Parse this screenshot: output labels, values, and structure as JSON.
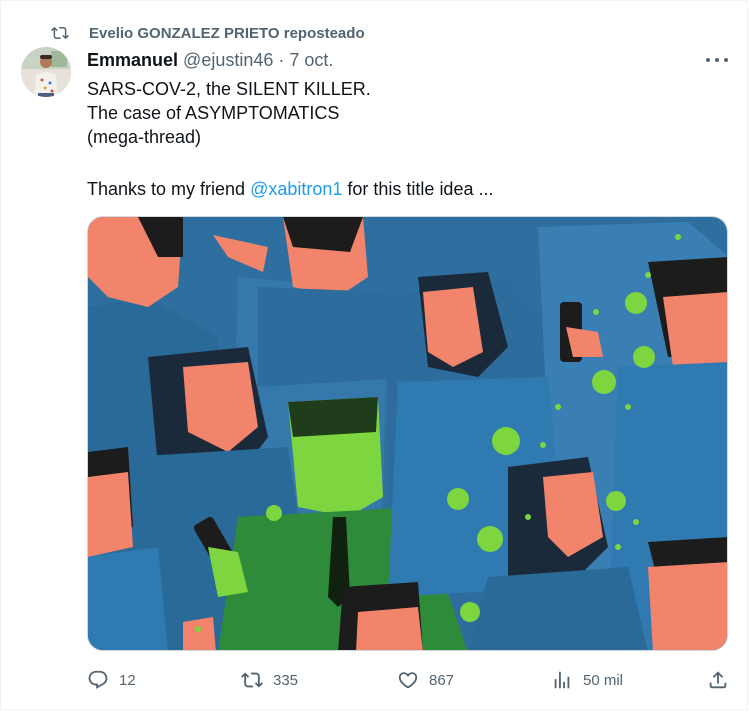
{
  "repost": {
    "icon": "repost-icon",
    "text": "Evelio GONZALEZ PRIETO reposteado"
  },
  "tweet": {
    "author_name": "Emmanuel",
    "author_handle": "@ejustin46",
    "separator": " · ",
    "date": "7 oct.",
    "lines": [
      "SARS-COV-2, the SILENT KILLER.",
      "The case of ASYMPTOMATICS",
      "(mega-thread)"
    ],
    "thanks_prefix": "Thanks to my friend ",
    "mention": "@xabitron1",
    "thanks_suffix": " for this title idea ..."
  },
  "actions": {
    "replies": "12",
    "reposts": "335",
    "likes": "867",
    "views": "50 mil"
  },
  "colors": {
    "accent": "#1d9bf0",
    "muted": "#536471",
    "media_bg": "#3a7fb3",
    "virus_green": "#7dd63f"
  }
}
